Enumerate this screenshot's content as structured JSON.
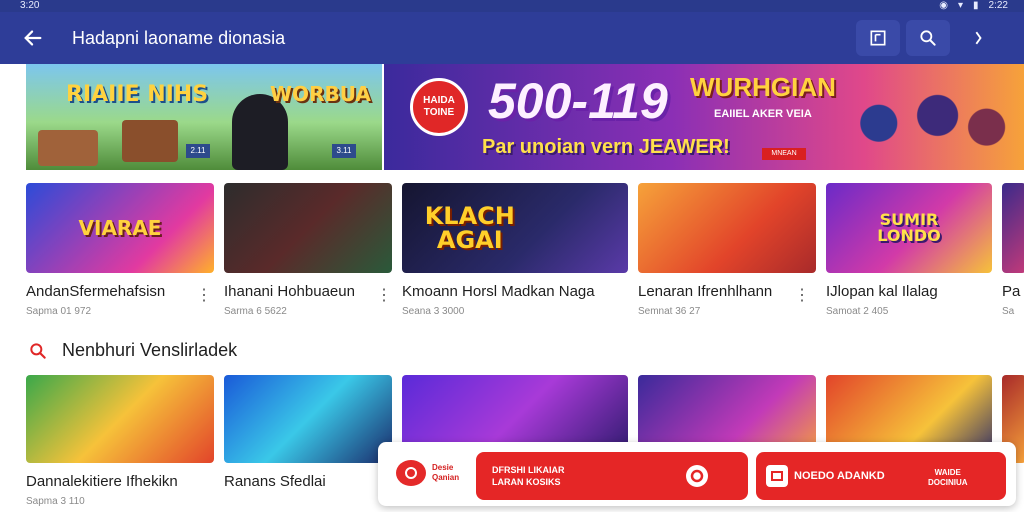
{
  "status": {
    "time": "3:20",
    "battery_time": "2:22"
  },
  "appbar": {
    "title": "Hadapni laoname dionasia"
  },
  "banners": {
    "left": {
      "logo_a": "RIAIIE NIHS",
      "logo_b": "WORBUA",
      "tag_a": "2.11",
      "tag_b": "3.11"
    },
    "right": {
      "badge_line1": "HAIDA",
      "badge_line2": "TOINE",
      "big": "500-119",
      "header": "WURHGIAN",
      "sub": "EAIIEL AKER VEIA",
      "tagline": "Par unoian vern JEAWER!",
      "cta": "MNEAN"
    }
  },
  "row1": [
    {
      "art": "VIARAE",
      "title": "AndanSfermehafsisn",
      "sub": "Sapma 01 972"
    },
    {
      "art": "",
      "title": "Ihanani Hohbuaeun",
      "sub": "Sarma 6 5622"
    },
    {
      "art": "KLACH AGAI",
      "title": "Kmoann Horsl Madkan Naga",
      "sub": "Seana 3 3000"
    },
    {
      "art": "",
      "title": "Lenaran Ifrenhlhann",
      "sub": "Semnat 36 27"
    },
    {
      "art": "SUMIR LONDO",
      "title": "IJlopan kal Ilalag",
      "sub": "Samoat 2 405"
    },
    {
      "art": "",
      "title": "Pa",
      "sub": "Sa"
    }
  ],
  "section": {
    "title": "Nenbhuri Venslirladek"
  },
  "row2": [
    {
      "title": "Dannalekitiere Ifhekikn",
      "sub": "Sapma 3 110"
    },
    {
      "title": "Ranans Sfedlai",
      "sub": ""
    },
    {
      "title": "",
      "sub": ""
    },
    {
      "title": "",
      "sub": ""
    },
    {
      "title": "",
      "sub": ""
    },
    {
      "title": "",
      "sub": ""
    }
  ],
  "bottom": {
    "logo_text_1": "Desie",
    "logo_text_2": "Qanian",
    "btn1_line1": "DFRSHI LIKAIAR",
    "btn1_line2": "LARAN KOSIKS",
    "btn2_label": "NOEDO ADANKD",
    "btn2_sub1": "WAIDE",
    "btn2_sub2": "DOCINIUA"
  },
  "colors": {
    "appbar": "#2e3d98",
    "accent_red": "#e52626"
  }
}
